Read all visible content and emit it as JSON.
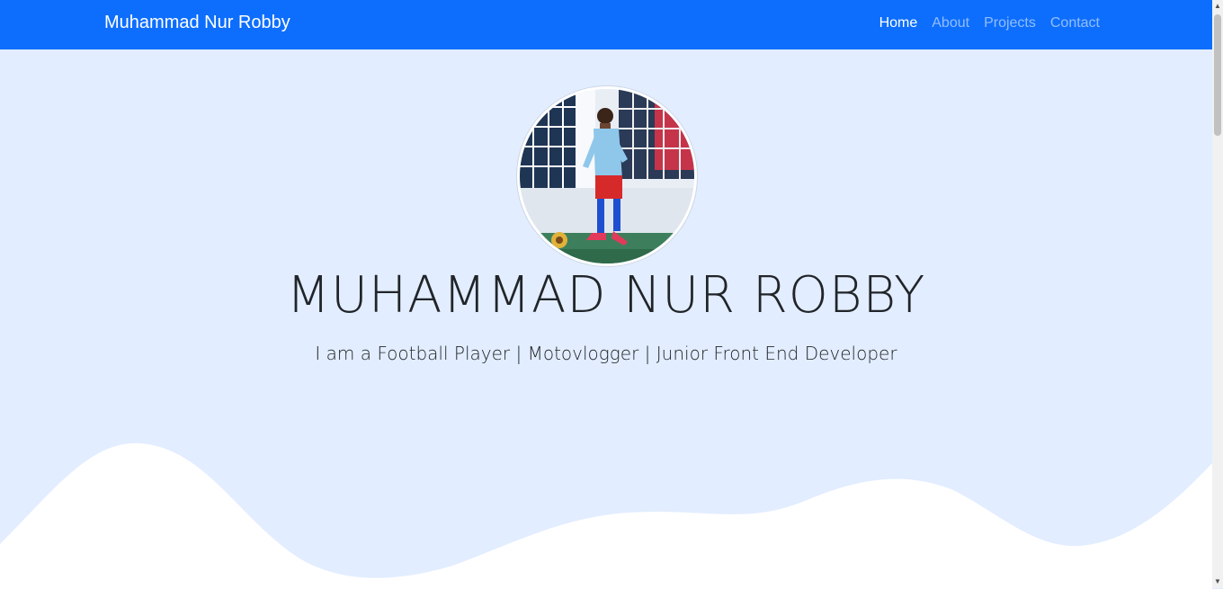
{
  "navbar": {
    "brand": "Muhammad Nur Robby",
    "links": [
      {
        "label": "Home",
        "active": true
      },
      {
        "label": "About",
        "active": false
      },
      {
        "label": "Projects",
        "active": false
      },
      {
        "label": "Contact",
        "active": false
      }
    ]
  },
  "hero": {
    "title": "MUHAMMAD NUR ROBBY",
    "lead": "I am a Football Player | Motovlogger | Junior Front End Developer"
  },
  "colors": {
    "navbar": "#0d6efd",
    "hero_background": "#e2edff",
    "wave": "#ffffff"
  },
  "icons": {
    "scroll_up": "triangle-up",
    "scroll_down": "triangle-down"
  }
}
